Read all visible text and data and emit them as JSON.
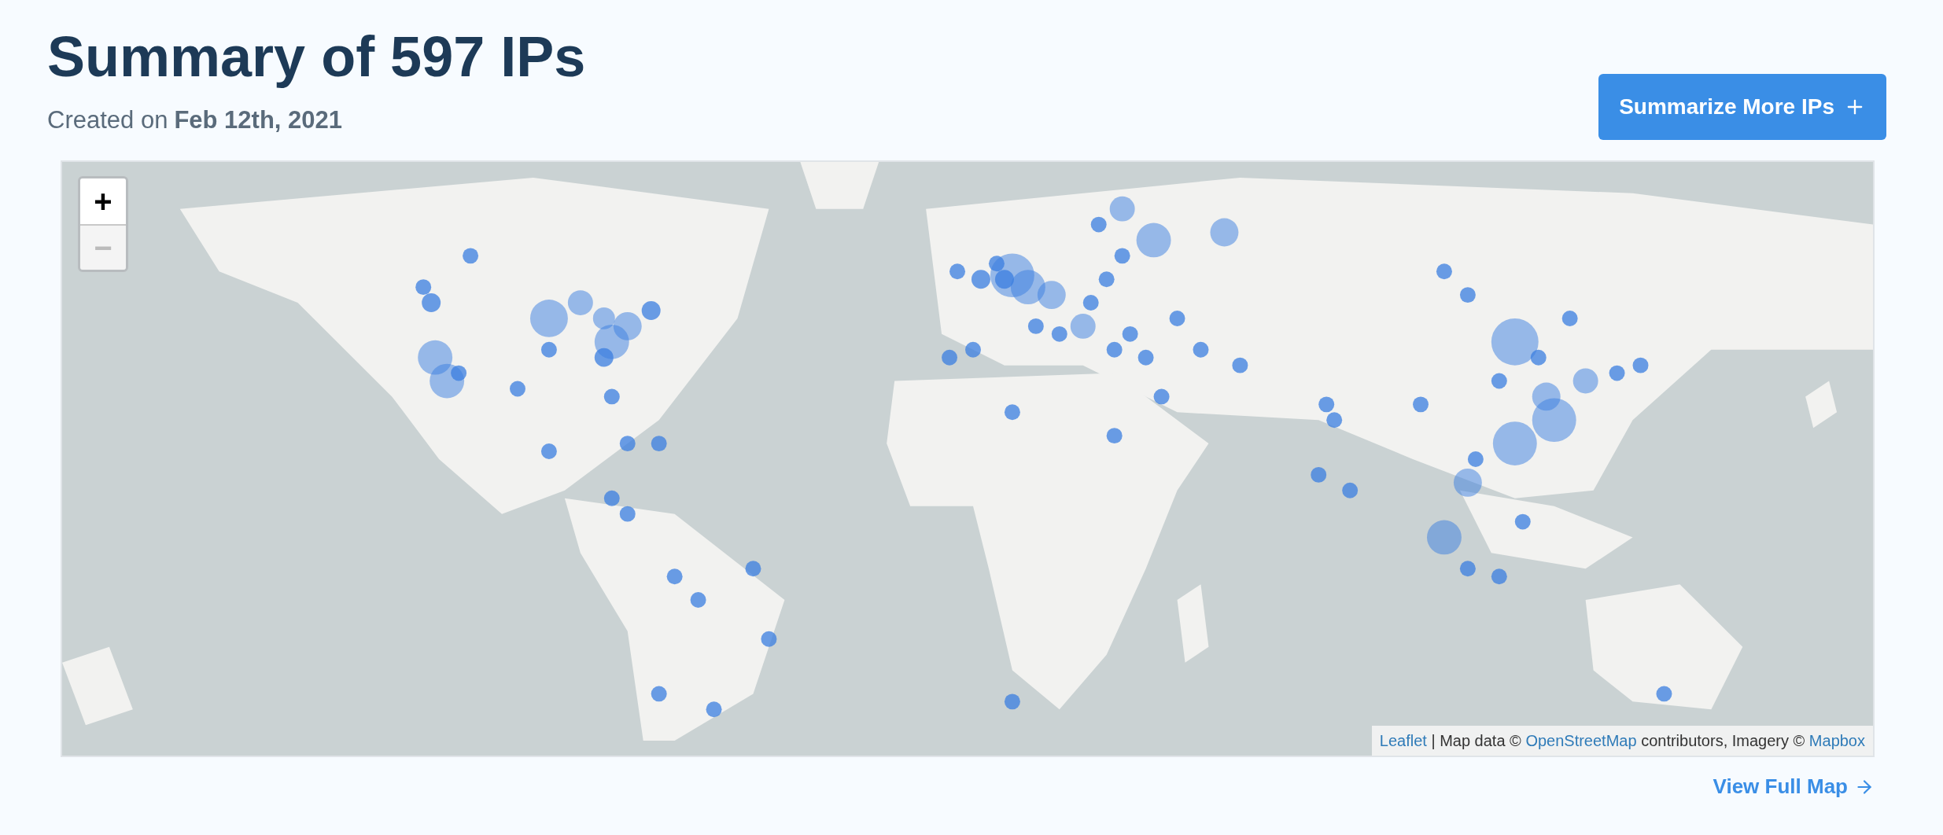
{
  "header": {
    "title": "Summary of 597 IPs",
    "created_prefix": "Created on",
    "created_date": "Feb 12th, 2021"
  },
  "summarize_button": {
    "label": "Summarize More IPs"
  },
  "map": {
    "zoom_controls": [
      {
        "label": "+",
        "disabled": false
      },
      {
        "label": "−",
        "disabled": true
      }
    ],
    "attribution": [
      {
        "text": "Leaflet",
        "link": true
      },
      {
        "text": " | Map data © ",
        "link": false
      },
      {
        "text": "OpenStreetMap",
        "link": true
      },
      {
        "text": " contributors, Imagery © ",
        "link": false
      },
      {
        "text": "Mapbox",
        "link": true
      }
    ]
  },
  "view_full_map": {
    "label": "View Full Map"
  }
}
